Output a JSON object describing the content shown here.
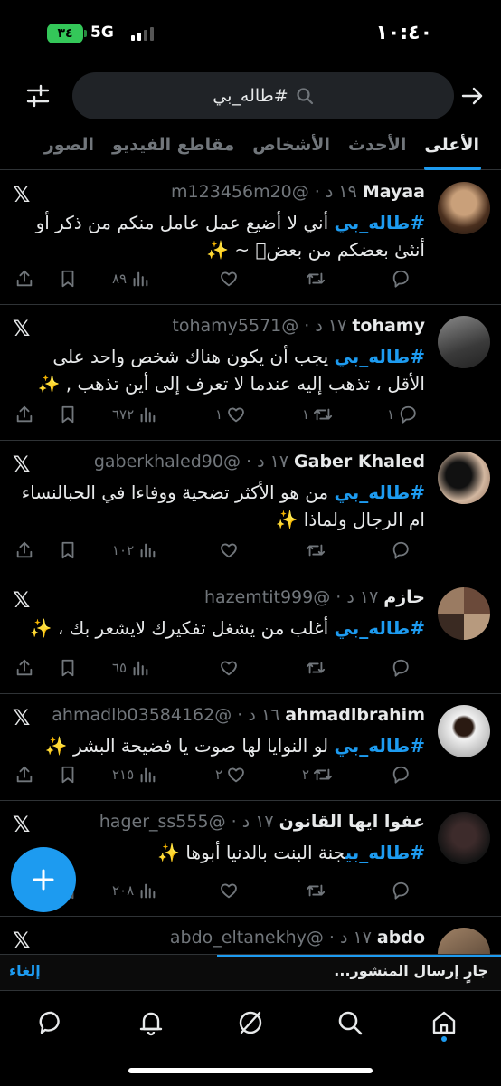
{
  "status_bar": {
    "time": "١٠:٤٠",
    "battery": "٣٤",
    "network": "5G"
  },
  "search": {
    "query": "#طاله_بي"
  },
  "tabs": [
    {
      "label": "الأعلى",
      "active": true
    },
    {
      "label": "الأحدث",
      "active": false
    },
    {
      "label": "الأشخاص",
      "active": false
    },
    {
      "label": "مقاطع الفيديو",
      "active": false
    },
    {
      "label": "الصور",
      "active": false
    }
  ],
  "posts": [
    {
      "name": "Mayaa",
      "meta": "m123456m20@ · ١٩ د",
      "hashtag": "#طاله_بي",
      "text": " أني لا أضيع عمل عامل منكم من ذكر أو أنثىٰ بعضكم من بعضۗ ~ ✨",
      "reply": "",
      "retweet": "",
      "like": "",
      "views": "٨٩"
    },
    {
      "name": "tohamy",
      "meta": "tohamy5571@ · ١٧ د",
      "hashtag": "#طاله_بي",
      "text": " يجب أن يكون هناك شخص واحد على الأقل ، تذهب إليه عندما لا تعرف إلى أين تذهب , ✨",
      "reply": "١",
      "retweet": "١",
      "like": "١",
      "views": "٦٧٢"
    },
    {
      "name": "Gaber Khaled",
      "meta": "gaberkhaled90@ · ١٧ د",
      "hashtag": "#طاله_بي",
      "text": " من هو الأكثر تضحية ووفاءا في الحبالنساء ام الرجال ولماذا ✨",
      "reply": "",
      "retweet": "",
      "like": "",
      "views": "١٠٢"
    },
    {
      "name": "حازم",
      "meta": "hazemtit999@ · ١٧ د",
      "hashtag": "#طاله_بي",
      "text": " أغلب من يشغل تفكيرك لايشعر بك ، ✨",
      "reply": "",
      "retweet": "",
      "like": "",
      "views": "٦٥"
    },
    {
      "name": "ahmadlbrahim",
      "meta": "ahmadlb03584162@ · ١٦ د",
      "hashtag": "#طاله_بي",
      "text": " لو النوايا لها صوت يا فضيحة البشر ✨",
      "reply": "",
      "retweet": "٢",
      "like": "٢",
      "views": "٢١٥"
    },
    {
      "name": "عفوا ايها القانون",
      "meta": "hager_ss555@ · ١٧ د",
      "hashtag": "#طاله_بي",
      "text": "جنة البنت بالدنيا أبوها ✨ ",
      "reply": "",
      "retweet": "",
      "like": "",
      "views": "٢٠٨"
    },
    {
      "name": "abdo",
      "meta": "abdo_eltanekhy@ · ١٧ د",
      "hashtag": "",
      "text": "",
      "reply": "",
      "retweet": "",
      "like": "",
      "views": ""
    }
  ],
  "sending": {
    "text": "جارٍ إرسال المنشور...",
    "cancel": "إلغاء"
  },
  "colors": {
    "accent": "#1d9bf0",
    "background": "#000000",
    "muted": "#71767b",
    "battery": "#34c759"
  },
  "icons": [
    "filter-icon",
    "search-icon",
    "back-arrow-icon",
    "x-logo-icon",
    "reply-icon",
    "retweet-icon",
    "like-icon",
    "views-icon",
    "bookmark-icon",
    "share-icon",
    "compose-icon",
    "home-icon",
    "explore-icon",
    "grok-icon",
    "notifications-icon",
    "messages-icon"
  ]
}
